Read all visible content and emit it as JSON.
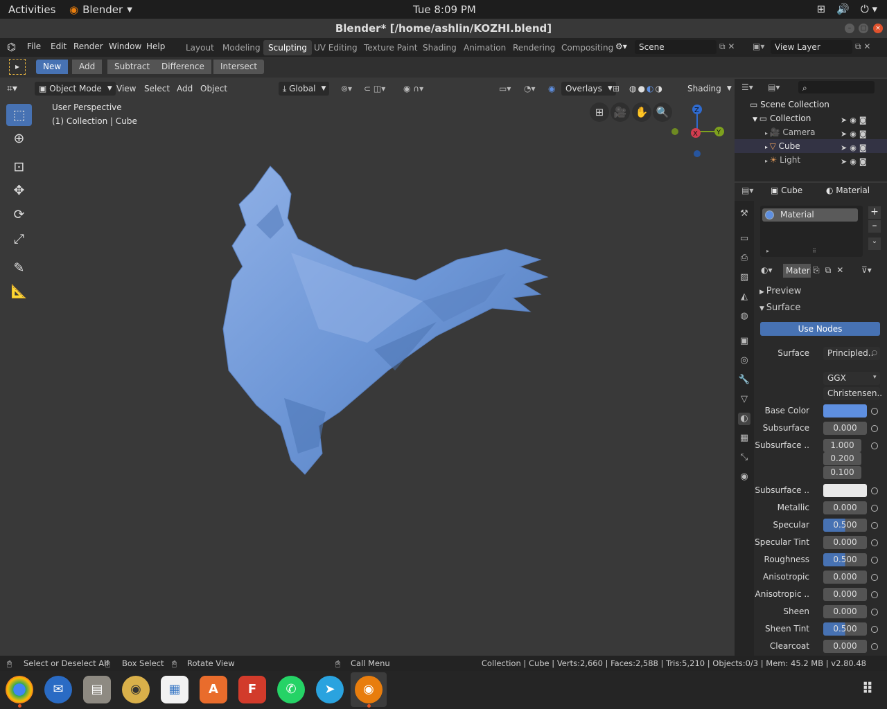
{
  "system": {
    "activities": "Activities",
    "app": "Blender",
    "clock": "Tue  8:09 PM"
  },
  "window": {
    "title": "Blender* [/home/ashlin/KOZHI.blend]"
  },
  "menu": [
    "File",
    "Edit",
    "Render",
    "Window",
    "Help"
  ],
  "workspaces": [
    "Layout",
    "Modeling",
    "Sculpting",
    "UV Editing",
    "Texture Paint",
    "Shading",
    "Animation",
    "Rendering",
    "Compositing"
  ],
  "scene": {
    "name": "Scene",
    "view_layer": "View Layer"
  },
  "boolean_ops": [
    "New",
    "Add",
    "Subtract",
    "Difference",
    "Intersect"
  ],
  "viewport": {
    "mode": "Object Mode",
    "menus": [
      "View",
      "Select",
      "Add",
      "Object"
    ],
    "orientation": "Global",
    "overlays": "Overlays",
    "shading": "Shading",
    "info_line1": "User Perspective",
    "info_line2": "(1) Collection | Cube",
    "axes": {
      "x": "X",
      "y": "Y",
      "z": "Z"
    }
  },
  "outliner": {
    "root": "Scene Collection",
    "collection": "Collection",
    "items": [
      "Camera",
      "Cube",
      "Light"
    ]
  },
  "properties": {
    "object": "Cube",
    "tab": "Material",
    "slot": "Material",
    "material_field": "Materi",
    "sections": {
      "preview": "Preview",
      "surface": "Surface"
    },
    "use_nodes": "Use Nodes",
    "rows": [
      {
        "label": "Surface",
        "value": "Principled.."
      },
      {
        "label": "",
        "value": "GGX"
      },
      {
        "label": "",
        "value": "Christensen.."
      },
      {
        "label": "Base Color",
        "value": ""
      },
      {
        "label": "Subsurface",
        "value": "0.000"
      },
      {
        "label": "Subsurface ..",
        "value": "1.000",
        "extra": [
          "0.200",
          "0.100"
        ]
      },
      {
        "label": "Subsurface ..",
        "value": ""
      },
      {
        "label": "Metallic",
        "value": "0.000"
      },
      {
        "label": "Specular",
        "value": "0.500"
      },
      {
        "label": "Specular Tint",
        "value": "0.000"
      },
      {
        "label": "Roughness",
        "value": "0.500"
      },
      {
        "label": "Anisotropic",
        "value": "0.000"
      },
      {
        "label": "Anisotropic ..",
        "value": "0.000"
      },
      {
        "label": "Sheen",
        "value": "0.000"
      },
      {
        "label": "Sheen Tint",
        "value": "0.500"
      },
      {
        "label": "Clearcoat",
        "value": "0.000"
      }
    ],
    "base_color": "#5e8fe0",
    "subsurface_color": "#e8e8e8"
  },
  "status": {
    "select": "Select or Deselect All",
    "box": "Box Select",
    "rotate": "Rotate View",
    "call": "Call Menu",
    "stats": "Collection | Cube | Verts:2,660 | Faces:2,588 | Tris:5,210 | Objects:0/3 | Mem: 45.2 MB | v2.80.48"
  },
  "dock_icons": [
    "chrome-icon",
    "thunderbird-icon",
    "files-icon",
    "rhythmbox-icon",
    "libreoffice-icon",
    "software-center-icon",
    "foxit-icon",
    "whatsapp-icon",
    "telegram-icon",
    "blender-icon",
    "app-grid-icon"
  ]
}
